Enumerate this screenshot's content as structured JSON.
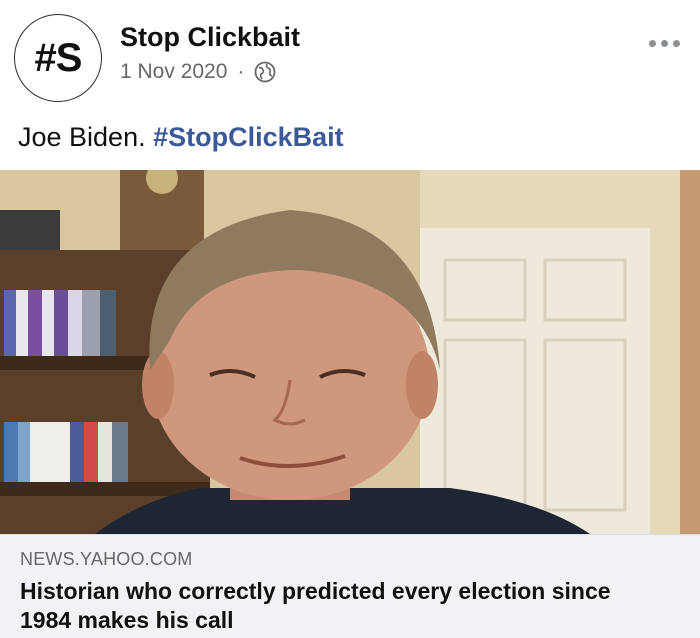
{
  "page": {
    "avatar_text": "#S",
    "name": "Stop Clickbait",
    "date": "1 Nov 2020",
    "separator": "·",
    "privacy_icon": "globe-icon",
    "more_icon": "more-options-icon"
  },
  "post": {
    "caption": "Joe Biden. ",
    "hashtag": "#StopClickBait"
  },
  "link_preview": {
    "domain": "NEWS.YAHOO.COM",
    "headline": "Historian who correctly predicted every election since 1984 makes his call"
  },
  "colors": {
    "hashtag": "#3b5998",
    "meta_text": "#65676b",
    "preview_bg": "#f0f2f5"
  }
}
